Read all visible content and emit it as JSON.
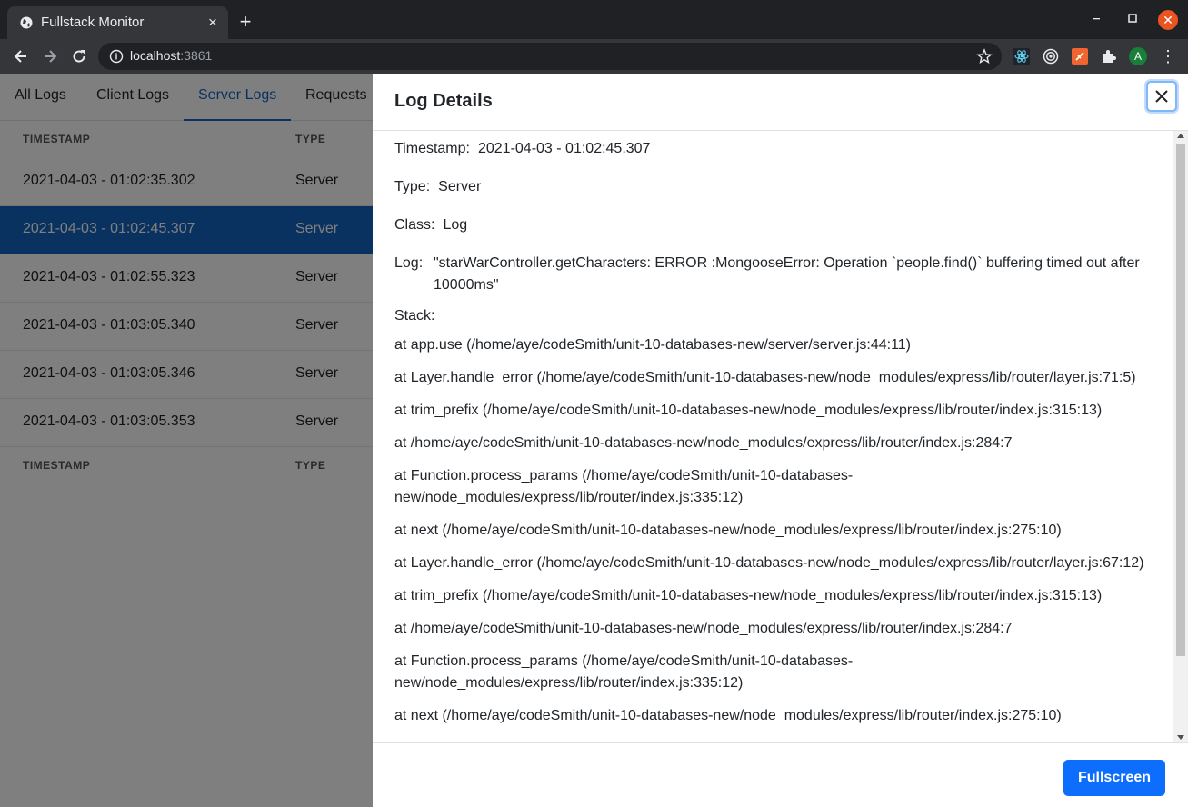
{
  "browser": {
    "tab_title": "Fullstack Monitor",
    "url_host": "localhost",
    "url_port": ":3861",
    "avatar_letter": "A"
  },
  "app": {
    "tabs": [
      {
        "label": "All Logs"
      },
      {
        "label": "Client Logs"
      },
      {
        "label": "Server Logs",
        "active": true
      },
      {
        "label": "Requests"
      }
    ],
    "table": {
      "headers": {
        "timestamp": "TIMESTAMP",
        "type": "TYPE"
      },
      "rows": [
        {
          "timestamp": "2021-04-03 - 01:02:35.302",
          "type": "Server"
        },
        {
          "timestamp": "2021-04-03 - 01:02:45.307",
          "type": "Server",
          "selected": true
        },
        {
          "timestamp": "2021-04-03 - 01:02:55.323",
          "type": "Server"
        },
        {
          "timestamp": "2021-04-03 - 01:03:05.340",
          "type": "Server"
        },
        {
          "timestamp": "2021-04-03 - 01:03:05.346",
          "type": "Server"
        },
        {
          "timestamp": "2021-04-03 - 01:03:05.353",
          "type": "Server"
        }
      ]
    }
  },
  "modal": {
    "title": "Log Details",
    "timestamp_label": "Timestamp:",
    "timestamp_value": "2021-04-03 - 01:02:45.307",
    "type_label": "Type:",
    "type_value": "Server",
    "class_label": "Class:",
    "class_value": "Log",
    "log_label": "Log:",
    "log_value": "\"starWarController.getCharacters: ERROR :MongooseError: Operation `people.find()` buffering timed out after 10000ms\"",
    "stack_label": "Stack:",
    "stack": [
      "at app.use (/home/aye/codeSmith/unit-10-databases-new/server/server.js:44:11)",
      "at Layer.handle_error (/home/aye/codeSmith/unit-10-databases-new/node_modules/express/lib/router/layer.js:71:5)",
      "at trim_prefix (/home/aye/codeSmith/unit-10-databases-new/node_modules/express/lib/router/index.js:315:13)",
      "at /home/aye/codeSmith/unit-10-databases-new/node_modules/express/lib/router/index.js:284:7",
      "at Function.process_params (/home/aye/codeSmith/unit-10-databases-new/node_modules/express/lib/router/index.js:335:12)",
      "at next (/home/aye/codeSmith/unit-10-databases-new/node_modules/express/lib/router/index.js:275:10)",
      "at Layer.handle_error (/home/aye/codeSmith/unit-10-databases-new/node_modules/express/lib/router/layer.js:67:12)",
      "at trim_prefix (/home/aye/codeSmith/unit-10-databases-new/node_modules/express/lib/router/index.js:315:13)",
      "at /home/aye/codeSmith/unit-10-databases-new/node_modules/express/lib/router/index.js:284:7",
      "at Function.process_params (/home/aye/codeSmith/unit-10-databases-new/node_modules/express/lib/router/index.js:335:12)",
      "at next (/home/aye/codeSmith/unit-10-databases-new/node_modules/express/lib/router/index.js:275:10)"
    ],
    "fullscreen_label": "Fullscreen"
  }
}
